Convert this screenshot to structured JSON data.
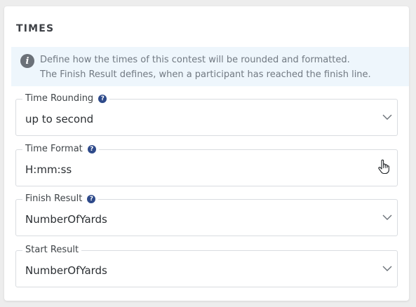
{
  "section": {
    "title": "TIMES"
  },
  "info": {
    "icon": "info-icon",
    "line1": "Define how the times of this contest will be rounded and formatted.",
    "line2": "The Finish Result defines, when a participant has reached the finish line."
  },
  "fields": [
    {
      "label": "Time Rounding",
      "value": "up to second",
      "help": "?",
      "control": "dropdown"
    },
    {
      "label": "Time Format",
      "value": "H:mm:ss",
      "help": "?",
      "control": "text"
    },
    {
      "label": "Finish Result",
      "value": "NumberOfYards",
      "help": "?",
      "control": "dropdown"
    },
    {
      "label": "Start Result",
      "value": "NumberOfYards",
      "control": "dropdown"
    }
  ],
  "colors": {
    "help_badge": "#2e4a8a",
    "info_background": "#eef6fc",
    "border": "#d9dce0"
  }
}
